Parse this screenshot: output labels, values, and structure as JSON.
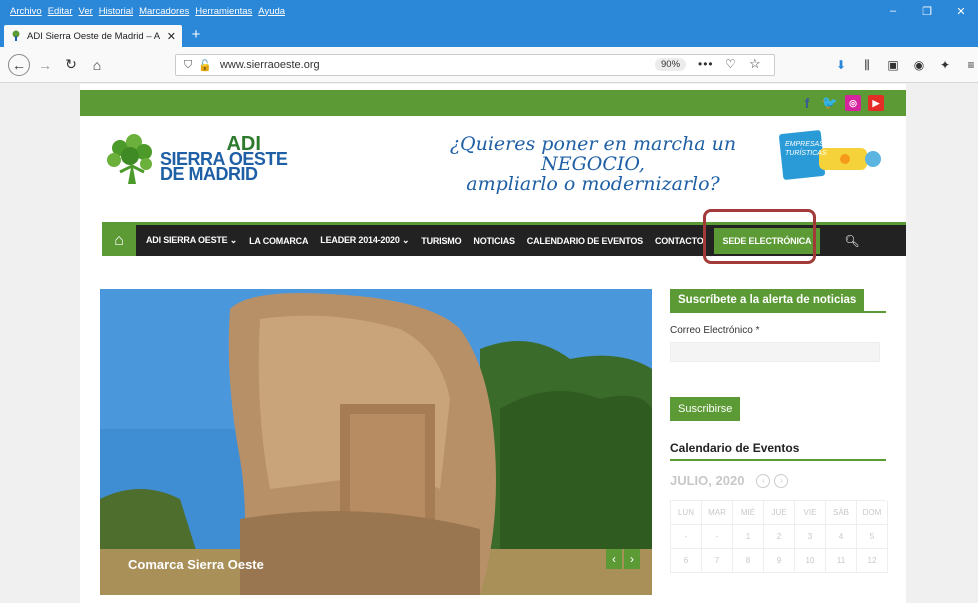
{
  "menubar": {
    "items": [
      "Archivo",
      "Editar",
      "Ver",
      "Historial",
      "Marcadores",
      "Herramientas",
      "Ayuda"
    ]
  },
  "window": {
    "minimize": "–",
    "maximize": "❐",
    "close": "✕"
  },
  "tab": {
    "title": "ADI Sierra Oeste de Madrid – A",
    "close": "✕",
    "new_tab": "+"
  },
  "navbar": {
    "url": "www.sierraoeste.org",
    "zoom": "90%",
    "more": "•••"
  },
  "site": {
    "header": {
      "logo_line1": "ADI",
      "logo_line2": "SIERRA OESTE",
      "logo_line3": "DE MADRID",
      "slogan_line1": "¿Quieres poner en marcha un NEGOCIO,",
      "slogan_line2": "ampliarlo o modernizarlo?",
      "badge_line1": "EMPRESAS",
      "badge_line2": "TURÍSTICAS"
    },
    "nav": {
      "items": [
        "ADI SIERRA OESTE ⌄",
        "LA COMARCA",
        "LEADER 2014-2020 ⌄",
        "TURISMO",
        "NOTICIAS",
        "CALENDARIO DE EVENTOS",
        "CONTACTO",
        "SEDE ELECTRÓNICA"
      ]
    },
    "slider": {
      "caption": "Comarca Sierra Oeste",
      "prev": "‹",
      "next": "›"
    },
    "sidebar": {
      "newsletter_title": "Suscríbete a la alerta de noticias",
      "email_label": "Correo Electrónico *",
      "subscribe_button": "Suscribirse",
      "calendar_title": "Calendario de Eventos",
      "month": "JULIO, 2020",
      "days": [
        "LUN",
        "MAR",
        "MIÉ",
        "JUE",
        "VIE",
        "SÁB",
        "DOM"
      ],
      "dates": [
        "-",
        "-",
        "1",
        "2",
        "3",
        "4",
        "5",
        "6",
        "7",
        "8",
        "9",
        "10",
        "11",
        "12"
      ]
    }
  },
  "colors": {
    "brand_green": "#5b9a35",
    "highlight_red": "#a23a3a",
    "firefox_blue": "#2b87d8"
  }
}
